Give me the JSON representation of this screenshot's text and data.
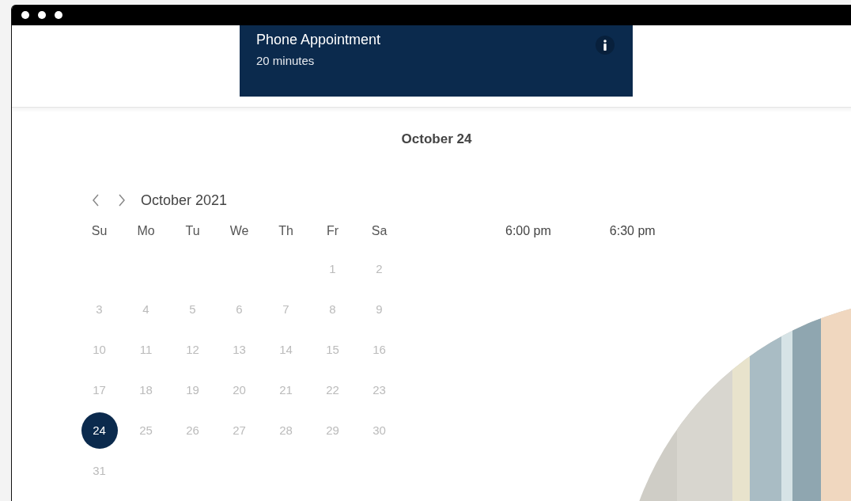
{
  "appointment": {
    "title": "Phone Appointment",
    "duration": "20 minutes"
  },
  "selected_date": "October 24",
  "calendar": {
    "month": "October 2021",
    "weekdays": [
      "Su",
      "Mo",
      "Tu",
      "We",
      "Th",
      "Fr",
      "Sa"
    ],
    "weeks": [
      {
        "kind": "partial",
        "days": [
          {
            "label": "1",
            "selected": false,
            "disabled": true
          },
          {
            "label": "2",
            "selected": false,
            "disabled": true
          }
        ]
      },
      {
        "kind": "full",
        "days": [
          {
            "label": "3",
            "selected": false,
            "disabled": true
          },
          {
            "label": "4",
            "selected": false,
            "disabled": true
          },
          {
            "label": "5",
            "selected": false,
            "disabled": true
          },
          {
            "label": "6",
            "selected": false,
            "disabled": true
          },
          {
            "label": "7",
            "selected": false,
            "disabled": true
          },
          {
            "label": "8",
            "selected": false,
            "disabled": true
          },
          {
            "label": "9",
            "selected": false,
            "disabled": true
          }
        ]
      },
      {
        "kind": "full",
        "days": [
          {
            "label": "10",
            "selected": false,
            "disabled": true
          },
          {
            "label": "11",
            "selected": false,
            "disabled": true
          },
          {
            "label": "12",
            "selected": false,
            "disabled": true
          },
          {
            "label": "13",
            "selected": false,
            "disabled": true
          },
          {
            "label": "14",
            "selected": false,
            "disabled": true
          },
          {
            "label": "15",
            "selected": false,
            "disabled": true
          },
          {
            "label": "16",
            "selected": false,
            "disabled": true
          }
        ]
      },
      {
        "kind": "full",
        "days": [
          {
            "label": "17",
            "selected": false,
            "disabled": true
          },
          {
            "label": "18",
            "selected": false,
            "disabled": true
          },
          {
            "label": "19",
            "selected": false,
            "disabled": true
          },
          {
            "label": "20",
            "selected": false,
            "disabled": true
          },
          {
            "label": "21",
            "selected": false,
            "disabled": true
          },
          {
            "label": "22",
            "selected": false,
            "disabled": true
          },
          {
            "label": "23",
            "selected": false,
            "disabled": true
          }
        ]
      },
      {
        "kind": "full",
        "days": [
          {
            "label": "24",
            "selected": true,
            "disabled": false
          },
          {
            "label": "25",
            "selected": false,
            "disabled": true
          },
          {
            "label": "26",
            "selected": false,
            "disabled": true
          },
          {
            "label": "27",
            "selected": false,
            "disabled": true
          },
          {
            "label": "28",
            "selected": false,
            "disabled": true
          },
          {
            "label": "29",
            "selected": false,
            "disabled": true
          },
          {
            "label": "30",
            "selected": false,
            "disabled": true
          }
        ]
      },
      {
        "kind": "last",
        "days": [
          {
            "label": "31",
            "selected": false,
            "disabled": true
          }
        ]
      }
    ]
  },
  "time_slots": [
    "6:00 pm",
    "6:30 pm"
  ]
}
